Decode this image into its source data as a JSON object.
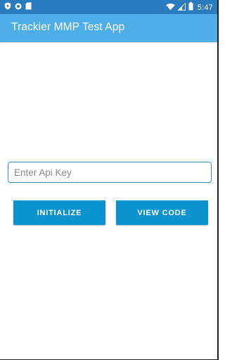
{
  "status_bar": {
    "time": "5:47",
    "left_icons": [
      "play-protect-icon",
      "circle-notification-icon",
      "sd-card-icon"
    ],
    "right_icons": [
      "wifi-icon",
      "signal-icon",
      "battery-icon"
    ]
  },
  "app_bar": {
    "title": "Trackier MMP Test App"
  },
  "api_key_input": {
    "placeholder": "Enter Api Key",
    "value": ""
  },
  "buttons": {
    "initialize_label": "INITIALIZE",
    "view_code_label": "VIEW CODE"
  },
  "colors": {
    "status_bar": "#2b7cbf",
    "app_bar": "#4eaee8",
    "button": "#0a93cf",
    "input_border": "#3b8fc7"
  }
}
